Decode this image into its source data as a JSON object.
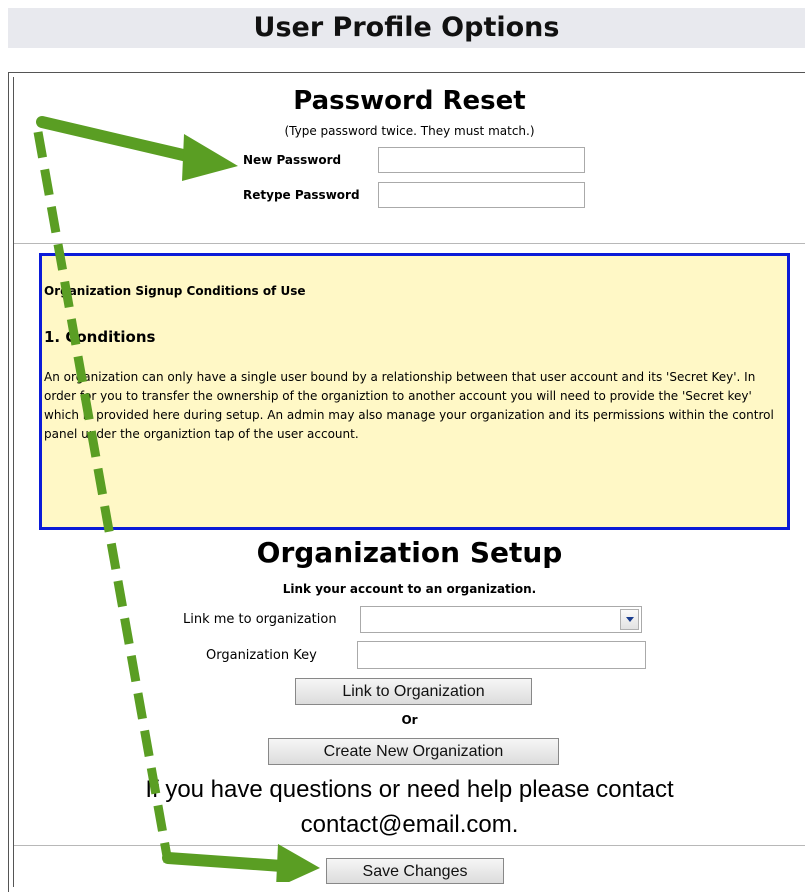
{
  "header": {
    "title": "User Profile Options"
  },
  "password_reset": {
    "title": "Password Reset",
    "hint": "(Type password twice. They must match.)",
    "new_password_label": "New Password",
    "retype_password_label": "Retype Password",
    "new_password_value": "",
    "retype_password_value": ""
  },
  "terms": {
    "heading": "Organization Signup Conditions of Use",
    "section_title": "1. Conditions",
    "body": "An organization can only have a single user bound by a relationship between that user account and its 'Secret Key'. In order for you to transfer the ownership of the organiztion to another account you will need to provide the 'Secret key' which is provided here during setup. An admin may also manage your organization and its permissions within the control panel under the organiztion tap of the user account.",
    "border_color": "#0b1bd8",
    "background_color": "#fff8c6"
  },
  "org_setup": {
    "title": "Organization Setup",
    "subtitle": "Link your account to an organization.",
    "link_label": "Link me to organization",
    "link_selected": "",
    "key_label": "Organization Key",
    "key_value": "",
    "link_button": "Link to Organization",
    "or_text": "Or",
    "create_button": "Create New Organization"
  },
  "help": {
    "line1": "If you have questions or need help please contact",
    "line2": "contact@email.com."
  },
  "footer": {
    "save_button": "Save Changes"
  },
  "annotations": {
    "arrow_color": "#5a9e23",
    "arrow_style": "green-arrow-icon"
  }
}
